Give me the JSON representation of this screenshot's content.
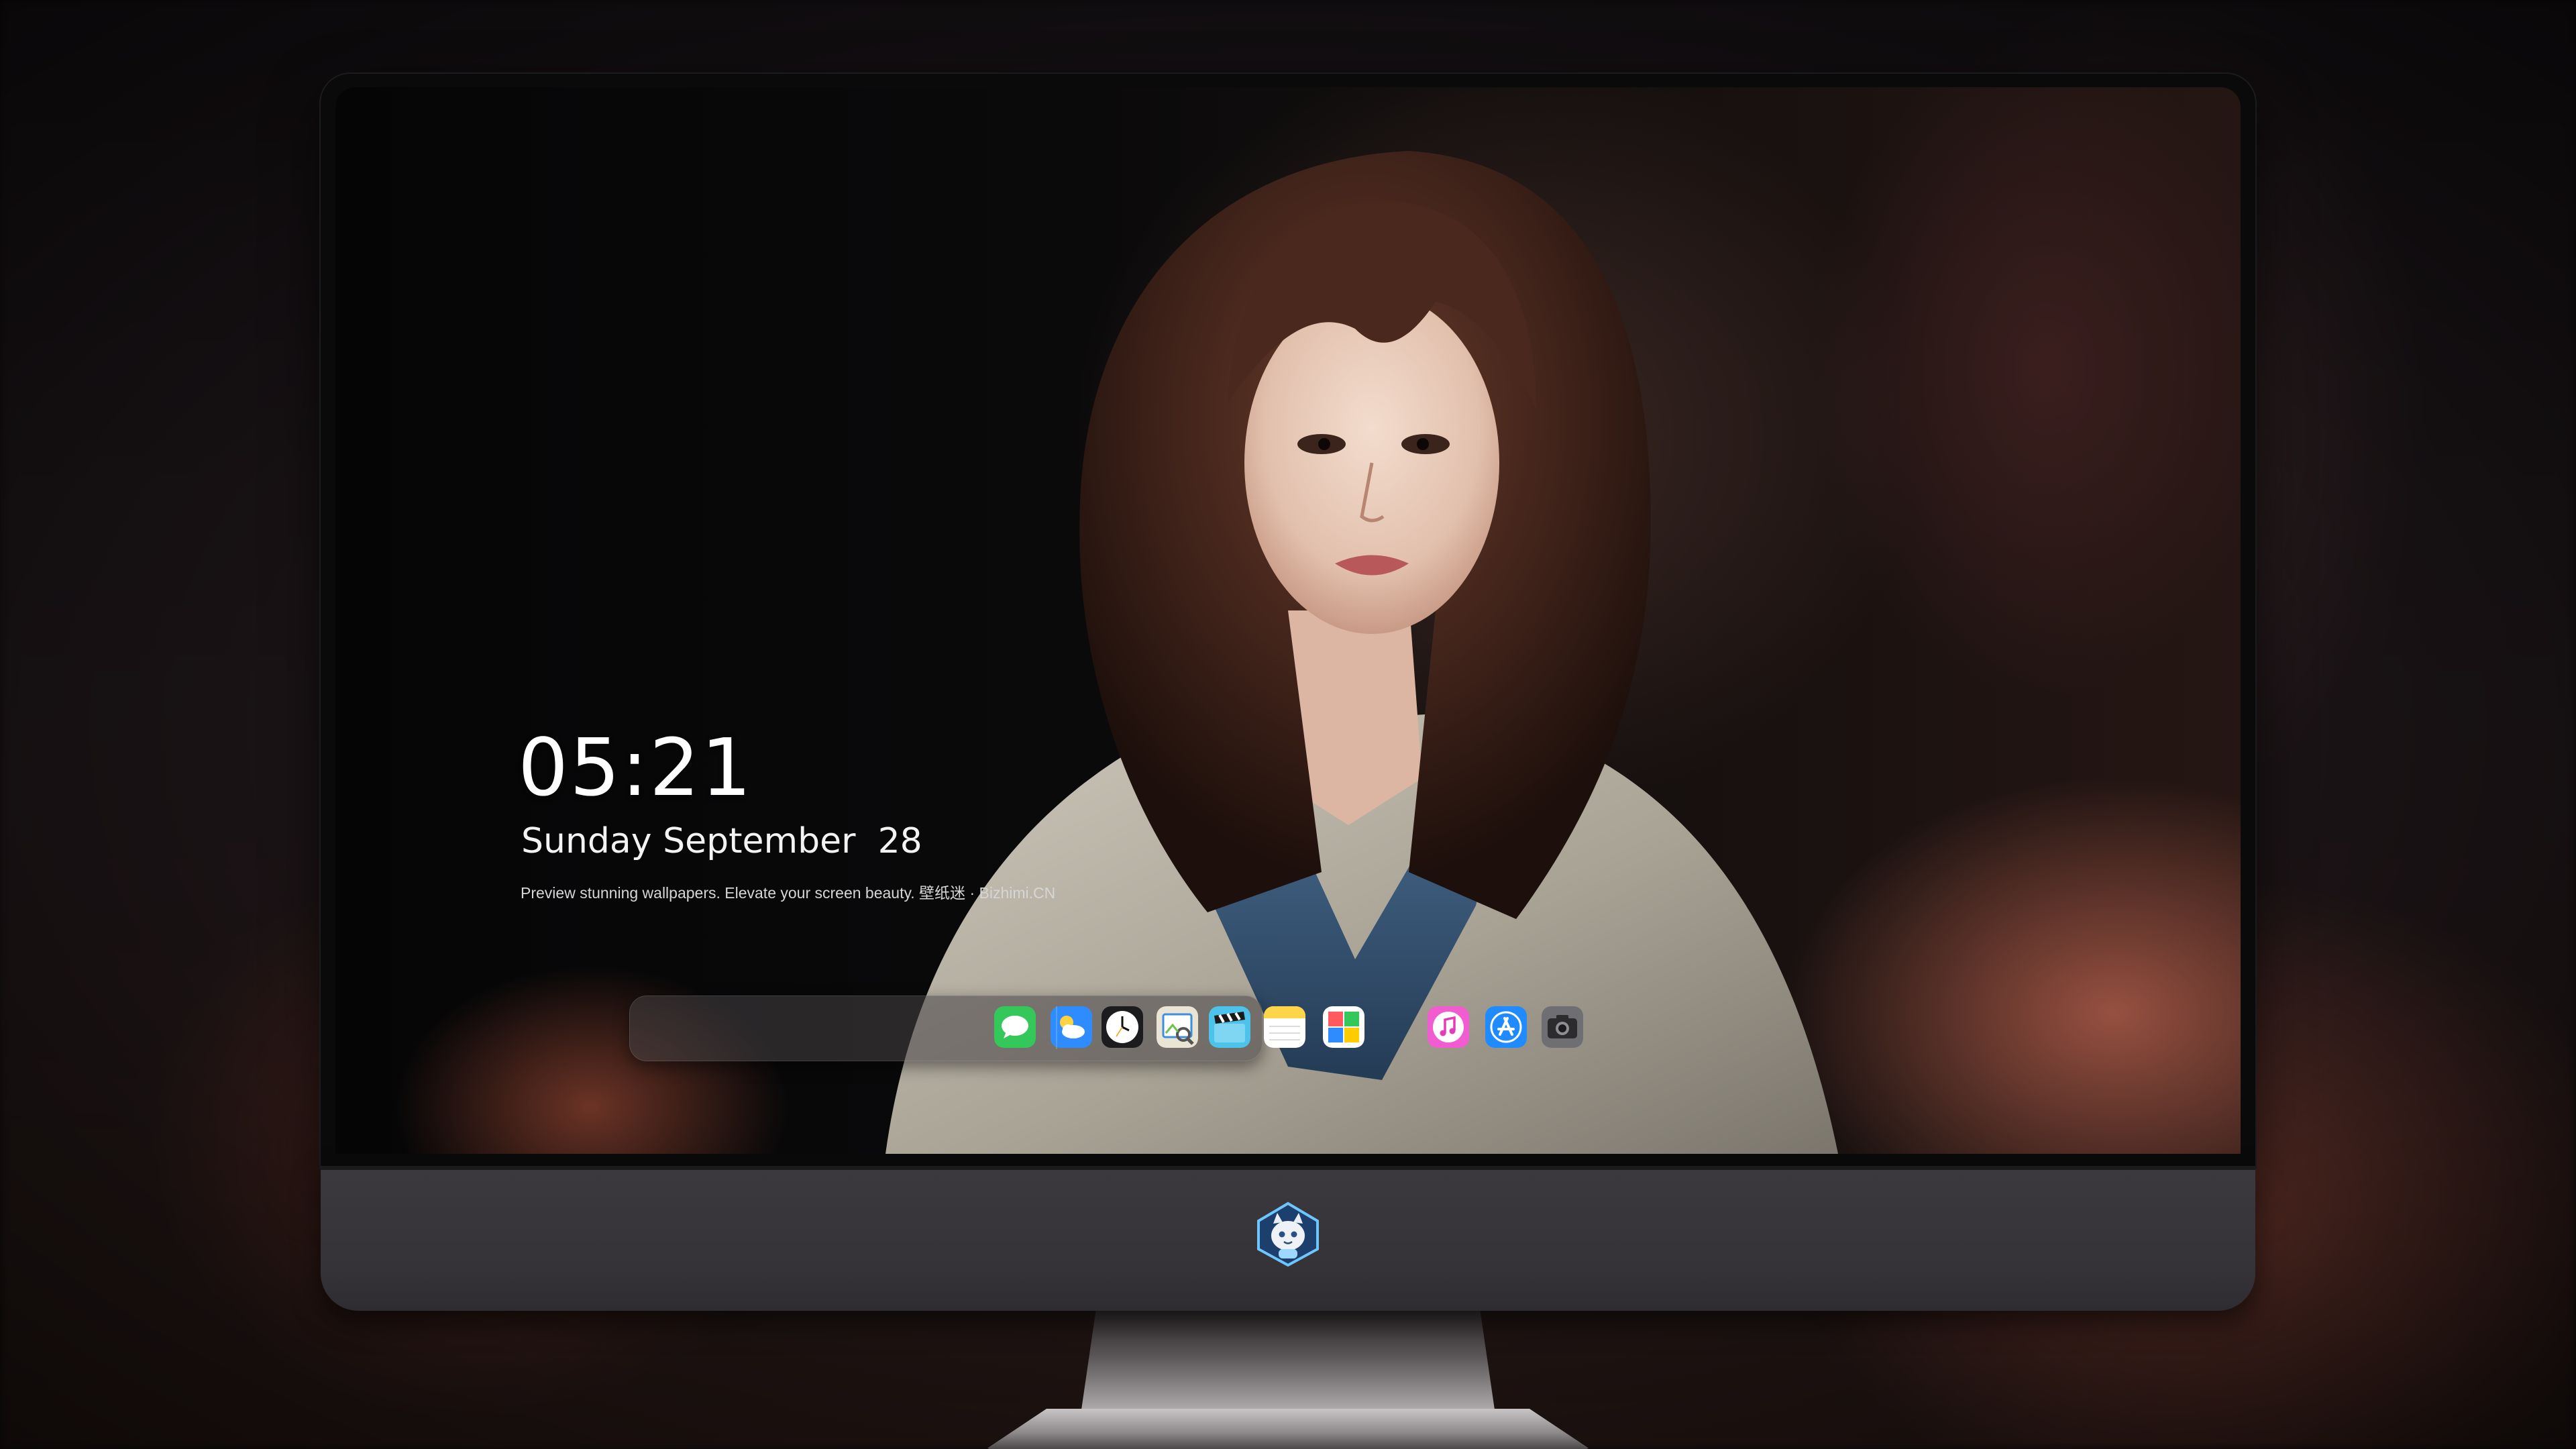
{
  "lockscreen": {
    "time": "05:21",
    "date": "Sunday September  28",
    "tagline": "Preview stunning wallpapers. Elevate your screen beauty. 壁纸迷 · Bizhimi.CN"
  },
  "dock": {
    "items": [
      {
        "name": "Messages",
        "icon": "messages-icon",
        "color": "#34c759"
      },
      {
        "name": "Weather",
        "icon": "weather-icon",
        "color": "#2f8cff"
      },
      {
        "name": "Clock",
        "icon": "clock-icon",
        "color": "#1c1c1e"
      },
      {
        "name": "Preview",
        "icon": "preview-icon",
        "color": "#e9e4d4"
      },
      {
        "name": "Clips",
        "icon": "clapperboard-icon",
        "color": "#4cc3ea"
      },
      {
        "name": "Notes",
        "icon": "notes-icon",
        "color": "#ffd54a"
      },
      {
        "name": "Photo Booth",
        "icon": "photo-booth-icon",
        "color": "#ffffff"
      },
      {
        "name": "Music",
        "icon": "music-icon",
        "color": "#f25cd1"
      },
      {
        "name": "App Store",
        "icon": "app-store-icon",
        "color": "#1f8bff"
      },
      {
        "name": "Camera",
        "icon": "camera-icon",
        "color": "#6e6e73"
      }
    ]
  },
  "monitor": {
    "bezel_color": "#0a0a0b",
    "chin_color": "#38363a",
    "logo": "cat-mascot-logo"
  }
}
